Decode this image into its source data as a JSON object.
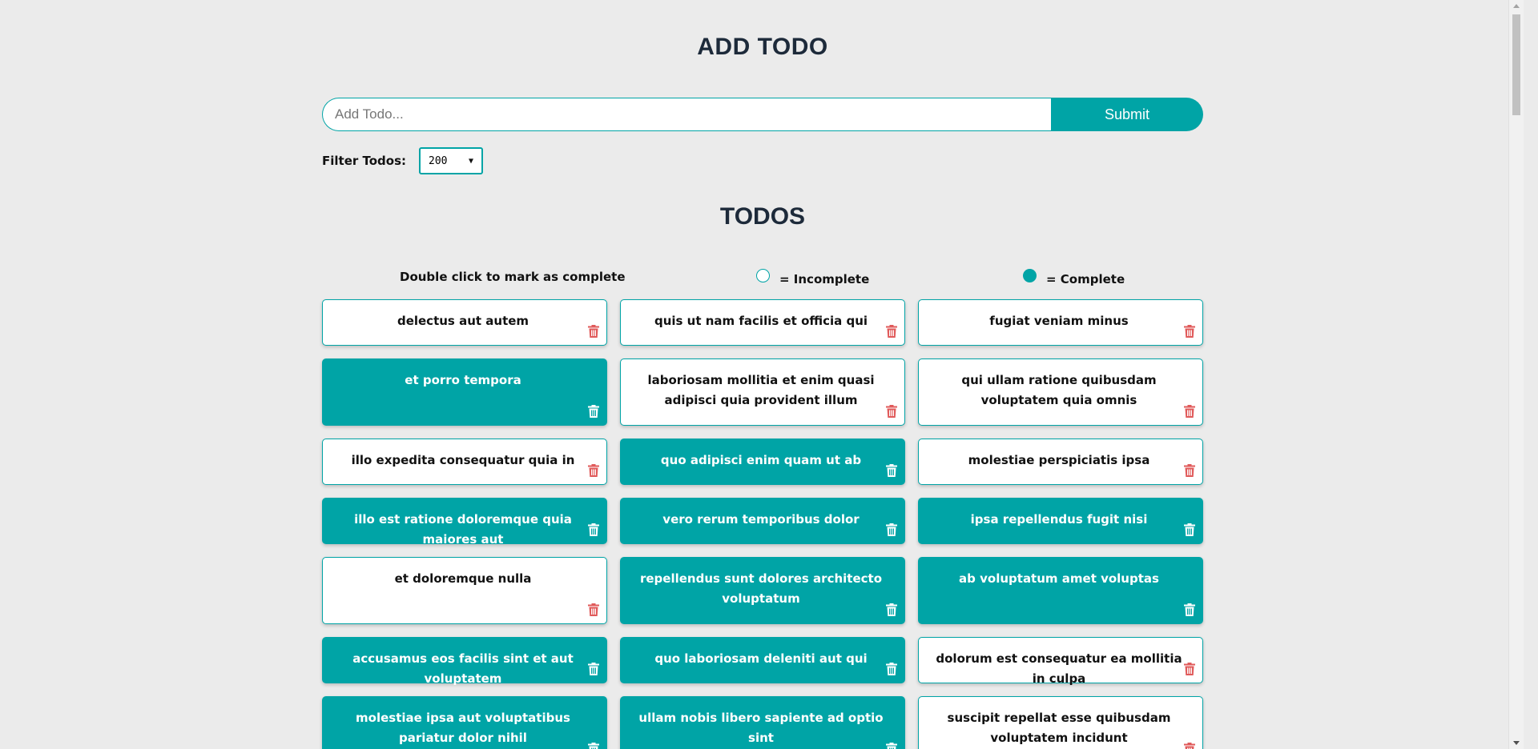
{
  "header": {
    "title": "ADD TODO"
  },
  "form": {
    "placeholder": "Add Todo...",
    "value": "",
    "submit_label": "Submit"
  },
  "filter": {
    "label": "Filter Todos:",
    "selected": "200"
  },
  "list": {
    "title": "TODOS",
    "hint": "Double click to mark as complete",
    "incomplete_label": "= Incomplete",
    "complete_label": "= Complete"
  },
  "colors": {
    "accent": "#00a4a6",
    "delete": "#e05a5a",
    "background": "#ebebeb"
  },
  "todos": [
    {
      "title": "delectus aut autem",
      "completed": false
    },
    {
      "title": "quis ut nam facilis et officia qui",
      "completed": false
    },
    {
      "title": "fugiat veniam minus",
      "completed": false
    },
    {
      "title": "et porro tempora",
      "completed": true
    },
    {
      "title": "laboriosam mollitia et enim quasi adipisci quia provident illum",
      "completed": false
    },
    {
      "title": "qui ullam ratione quibusdam voluptatem quia omnis",
      "completed": false
    },
    {
      "title": "illo expedita consequatur quia in",
      "completed": false
    },
    {
      "title": "quo adipisci enim quam ut ab",
      "completed": true
    },
    {
      "title": "molestiae perspiciatis ipsa",
      "completed": false
    },
    {
      "title": "illo est ratione doloremque quia maiores aut",
      "completed": true
    },
    {
      "title": "vero rerum temporibus dolor",
      "completed": true
    },
    {
      "title": "ipsa repellendus fugit nisi",
      "completed": true
    },
    {
      "title": "et doloremque nulla",
      "completed": false
    },
    {
      "title": "repellendus sunt dolores architecto voluptatum",
      "completed": true
    },
    {
      "title": "ab voluptatum amet voluptas",
      "completed": true
    },
    {
      "title": "accusamus eos facilis sint et aut voluptatem",
      "completed": true
    },
    {
      "title": "quo laboriosam deleniti aut qui",
      "completed": true
    },
    {
      "title": "dolorum est consequatur ea mollitia in culpa",
      "completed": false
    },
    {
      "title": "molestiae ipsa aut voluptatibus pariatur dolor nihil",
      "completed": true
    },
    {
      "title": "ullam nobis libero sapiente ad optio sint",
      "completed": true
    },
    {
      "title": "suscipit repellat esse quibusdam voluptatem incidunt",
      "completed": false
    }
  ]
}
